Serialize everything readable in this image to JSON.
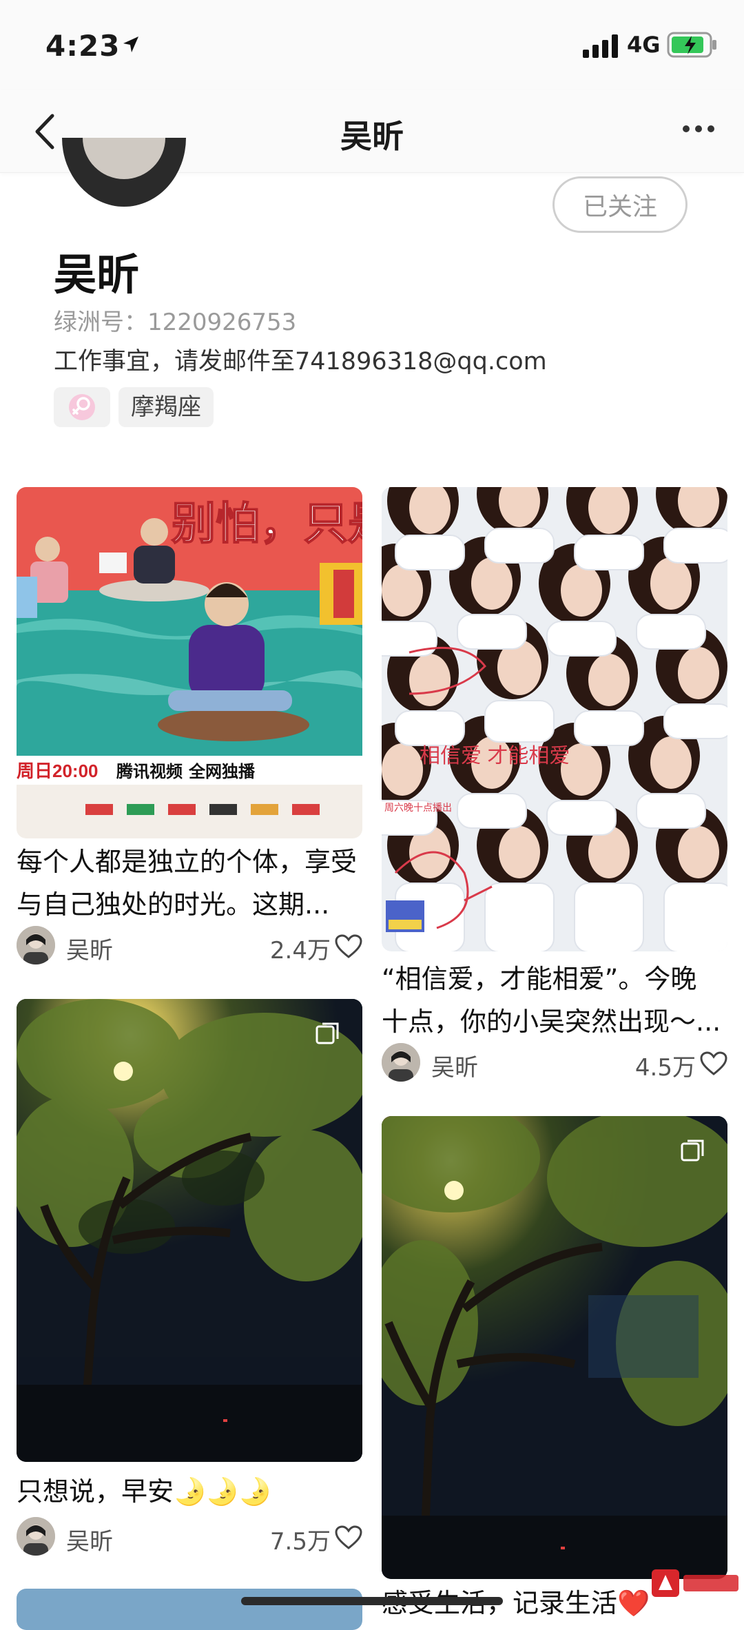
{
  "status_bar": {
    "time": "4:23",
    "network": "4G"
  },
  "nav": {
    "title": "吴昕"
  },
  "profile": {
    "name": "吴昕",
    "follow_label": "已关注",
    "oasis_id": "绿洲号：1220926753",
    "bio": "工作事宜，请发邮件至741896318@qq.com",
    "zodiac": "摩羯座"
  },
  "posts": [
    {
      "caption_line1": "每个人都是独立的个体，享受",
      "caption_line2": "与自己独处的时光。这期...",
      "author": "吴昕",
      "likes": "2.4万",
      "poster": {
        "headline": "别怕，只是",
        "date": "周日20:00",
        "platform": "腾讯视频",
        "exclusive": "全网独播"
      }
    },
    {
      "caption_line1": "“相信爱，才能相爱”。今晚",
      "caption_line2": "十点，你的小吴突然出现～...",
      "author": "吴昕",
      "likes": "4.5万",
      "poster": {
        "quote": "相信爱 才能相爱",
        "time_text": "周六晚十点播出"
      }
    },
    {
      "caption_line1": "只想说，早安🌛🌛🌛",
      "author": "吴昕",
      "likes": "7.5万"
    },
    {
      "caption_line1": "感受生活，记录生活❤️"
    }
  ],
  "colors": {
    "accent_pink": "#e87ab0",
    "poster_red": "#e9453f",
    "sea": "#2ea79c"
  }
}
